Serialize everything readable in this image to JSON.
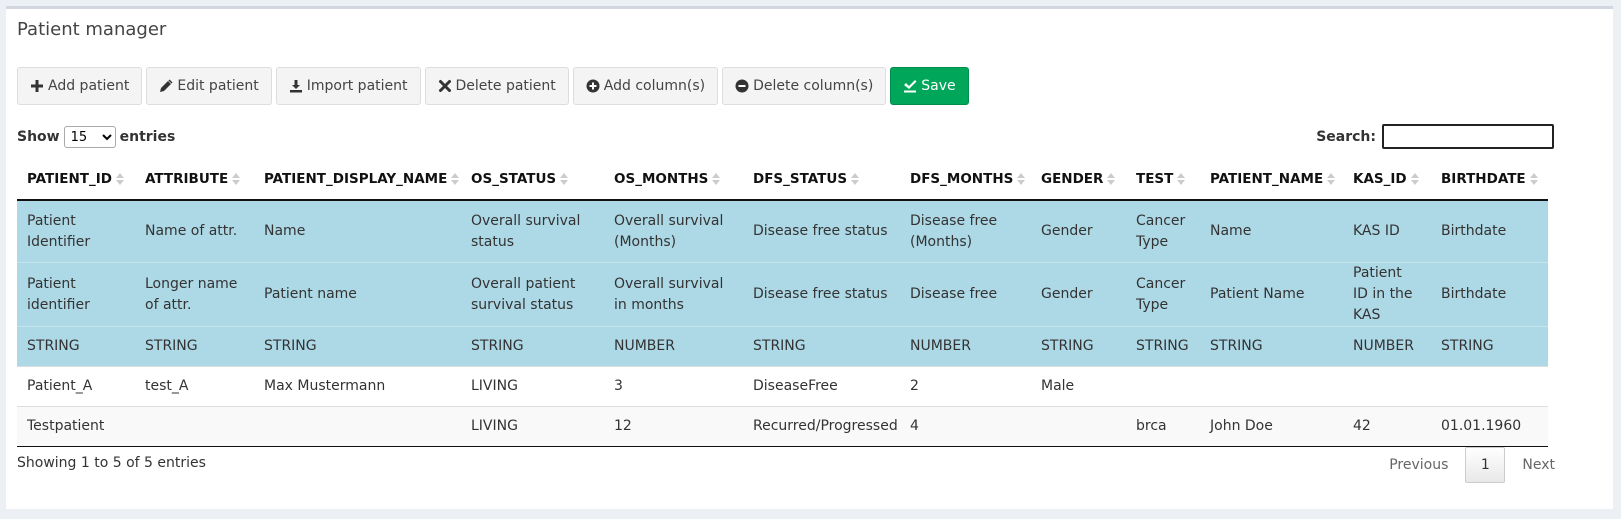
{
  "title": "Patient manager",
  "toolbar": {
    "add_patient": "Add patient",
    "edit_patient": "Edit patient",
    "import_patient": "Import patient",
    "delete_patient": "Delete patient",
    "add_columns": "Add column(s)",
    "delete_columns": "Delete column(s)",
    "save": "Save"
  },
  "length": {
    "show": "Show",
    "entries": "entries",
    "selected": "15"
  },
  "search": {
    "label": "Search:",
    "value": ""
  },
  "table": {
    "headers": [
      "PATIENT_ID",
      "ATTRIBUTE",
      "PATIENT_DISPLAY_NAME",
      "OS_STATUS",
      "OS_MONTHS",
      "DFS_STATUS",
      "DFS_MONTHS",
      "GENDER",
      "TEST",
      "PATIENT_NAME",
      "KAS_ID",
      "BIRTHDATE"
    ],
    "meta_rows": [
      [
        "Patient Identifier",
        "Name of attr.",
        "Name",
        "Overall survival status",
        "Overall survival (Months)",
        "Disease free status",
        "Disease free (Months)",
        "Gender",
        "Cancer Type",
        "Name",
        "KAS ID",
        "Birthdate"
      ],
      [
        "Patient identifier",
        "Longer name of attr.",
        "Patient name",
        "Overall patient survival status",
        "Overall survival in months",
        "Disease free status",
        "Disease free",
        "Gender",
        "Cancer Type",
        "Patient Name",
        "Patient ID in the KAS",
        "Birthdate"
      ],
      [
        "STRING",
        "STRING",
        "STRING",
        "STRING",
        "NUMBER",
        "STRING",
        "NUMBER",
        "STRING",
        "STRING",
        "STRING",
        "NUMBER",
        "STRING"
      ]
    ],
    "rows": [
      [
        "Patient_A",
        "test_A",
        "Max Mustermann",
        "LIVING",
        "3",
        "DiseaseFree",
        "2",
        "Male",
        "",
        "",
        "",
        ""
      ],
      [
        "Testpatient",
        "",
        "",
        "LIVING",
        "12",
        "Recurred/Progressed",
        "4",
        "",
        "brca",
        "John Doe",
        "42",
        "01.01.1960"
      ]
    ]
  },
  "footer": {
    "info": "Showing 1 to 5 of 5 entries",
    "previous": "Previous",
    "page": "1",
    "next": "Next"
  },
  "colors": {
    "meta_bg": "#add8e6",
    "save_bg": "#00a65a"
  }
}
